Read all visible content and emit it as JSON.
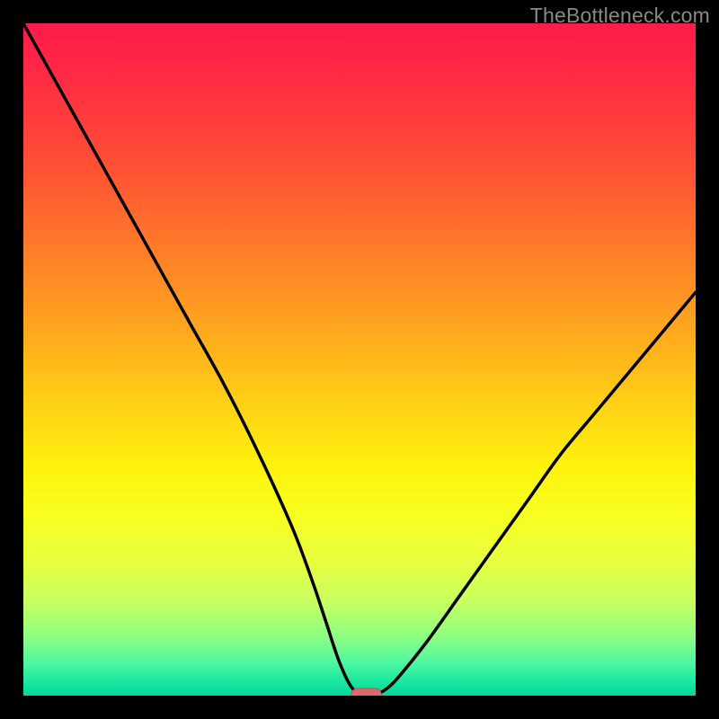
{
  "watermark": "TheBottleneck.com",
  "chart_data": {
    "type": "line",
    "title": "",
    "xlabel": "",
    "ylabel": "",
    "xlim": [
      0,
      100
    ],
    "ylim": [
      0,
      100
    ],
    "grid": false,
    "series": [
      {
        "name": "curve",
        "x": [
          0,
          5,
          10,
          15,
          20,
          25,
          30,
          35,
          40,
          43,
          45,
          47,
          49,
          51,
          52,
          54,
          56,
          60,
          65,
          70,
          75,
          80,
          85,
          90,
          95,
          100
        ],
        "values": [
          100,
          91,
          82,
          73,
          64,
          55,
          46,
          36,
          25,
          17,
          11,
          5,
          1,
          0,
          0,
          1,
          3,
          8,
          15,
          22,
          29,
          36,
          42,
          48,
          54,
          60
        ]
      }
    ],
    "marker": {
      "x": 51,
      "y": 0
    },
    "background_gradient": {
      "stops": [
        {
          "pos": 0.0,
          "color": "#ff1a4a"
        },
        {
          "pos": 0.5,
          "color": "#ffd614"
        },
        {
          "pos": 0.8,
          "color": "#e8ff40"
        },
        {
          "pos": 1.0,
          "color": "#06d49a"
        }
      ]
    }
  }
}
